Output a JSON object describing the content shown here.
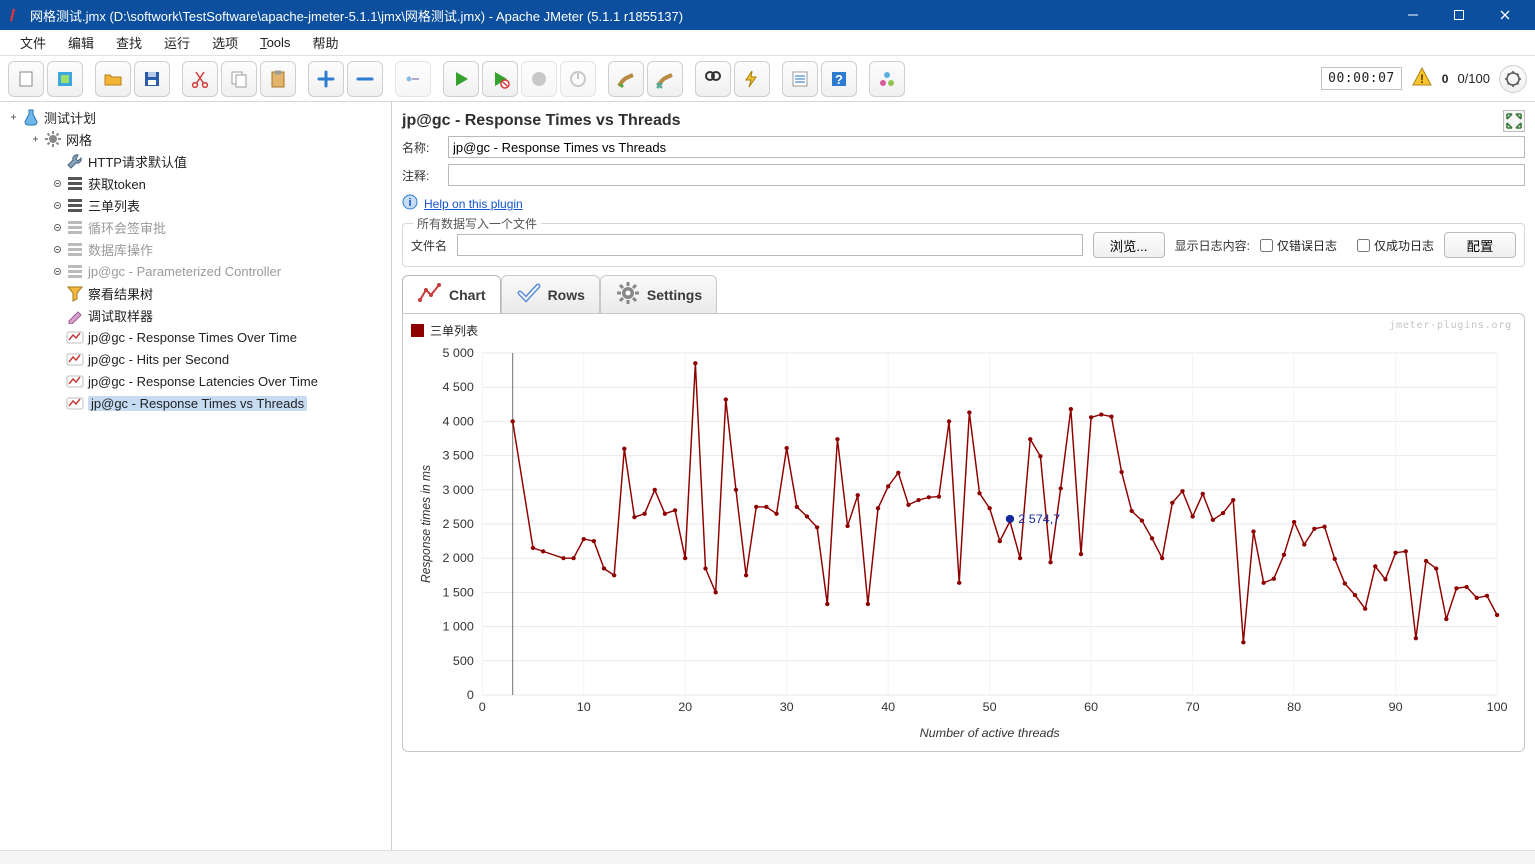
{
  "titlebar": {
    "title": "网格测试.jmx (D:\\softwork\\TestSoftware\\apache-jmeter-5.1.1\\jmx\\网格测试.jmx) - Apache JMeter (5.1.1 r1855137)"
  },
  "menubar": {
    "items": [
      "文件",
      "编辑",
      "查找",
      "运行",
      "选项",
      "Tools",
      "帮助"
    ]
  },
  "toolbar": {
    "timer": "00:00:07",
    "warn_count": "0",
    "thread_count": "0/100"
  },
  "tree": {
    "items": [
      {
        "label": "测试计划",
        "indent": 0,
        "toggle": "open",
        "icon": "flask"
      },
      {
        "label": "网格",
        "indent": 1,
        "toggle": "open",
        "icon": "gear"
      },
      {
        "label": "HTTP请求默认值",
        "indent": 2,
        "icon": "wrench"
      },
      {
        "label": "获取token",
        "indent": 2,
        "toggle": "closed",
        "icon": "bars"
      },
      {
        "label": "三单列表",
        "indent": 2,
        "toggle": "closed",
        "icon": "bars"
      },
      {
        "label": "循环会签审批",
        "indent": 2,
        "toggle": "closed",
        "icon": "bars-disabled",
        "disabled": true
      },
      {
        "label": "数据库操作",
        "indent": 2,
        "toggle": "closed",
        "icon": "bars-disabled",
        "disabled": true
      },
      {
        "label": "jp@gc - Parameterized Controller",
        "indent": 2,
        "toggle": "closed",
        "icon": "bars-disabled",
        "disabled": true
      },
      {
        "label": "察看结果树",
        "indent": 2,
        "icon": "funnel"
      },
      {
        "label": "调试取样器",
        "indent": 2,
        "icon": "pen"
      },
      {
        "label": "jp@gc - Response Times Over Time",
        "indent": 2,
        "icon": "jp"
      },
      {
        "label": "jp@gc - Hits per Second",
        "indent": 2,
        "icon": "jp"
      },
      {
        "label": "jp@gc - Response Latencies Over Time",
        "indent": 2,
        "icon": "jp"
      },
      {
        "label": "jp@gc - Response Times vs Threads",
        "indent": 2,
        "icon": "jp",
        "selected": true
      }
    ]
  },
  "main": {
    "header": "jp@gc - Response Times vs Threads",
    "name_label": "名称:",
    "name_value": "jp@gc - Response Times vs Threads",
    "comment_label": "注释:",
    "comment_value": "",
    "help_link": "Help on this plugin",
    "fieldset_legend": "所有数据写入一个文件",
    "filename_label": "文件名",
    "filename_value": "",
    "browse_btn": "浏览...",
    "showlog_label": "显示日志内容:",
    "cb_error": "仅错误日志",
    "cb_success": "仅成功日志",
    "config_btn": "配置"
  },
  "tabs": {
    "chart": "Chart",
    "rows": "Rows",
    "settings": "Settings"
  },
  "legend": {
    "series_name": "三单列表"
  },
  "watermark": "jmeter-plugins.org",
  "tooltip": {
    "label": "2 574,7"
  },
  "chart_data": {
    "type": "line",
    "title": "",
    "xlabel": "Number of active threads",
    "ylabel": "Response times in ms",
    "xlim": [
      0,
      100
    ],
    "ylim": [
      0,
      5000
    ],
    "x_ticks": [
      0,
      10,
      20,
      30,
      40,
      50,
      60,
      70,
      80,
      90,
      100
    ],
    "y_ticks": [
      0,
      500,
      1000,
      1500,
      2000,
      2500,
      3000,
      3500,
      4000,
      4500,
      5000
    ],
    "series": [
      {
        "name": "三单列表",
        "color": "#8e0000",
        "x": [
          3,
          5,
          6,
          8,
          9,
          10,
          11,
          12,
          13,
          14,
          15,
          16,
          17,
          18,
          19,
          20,
          21,
          22,
          23,
          24,
          25,
          26,
          27,
          28,
          29,
          30,
          31,
          32,
          33,
          34,
          35,
          36,
          37,
          38,
          39,
          40,
          41,
          42,
          43,
          44,
          45,
          46,
          47,
          48,
          49,
          50,
          51,
          52,
          53,
          54,
          55,
          56,
          57,
          58,
          59,
          60,
          61,
          62,
          63,
          64,
          65,
          66,
          67,
          68,
          69,
          70,
          71,
          72,
          73,
          74,
          75,
          76,
          77,
          78,
          79,
          80,
          81,
          82,
          83,
          84,
          85,
          86,
          87,
          88,
          89,
          90,
          91,
          92,
          93,
          94,
          95,
          96,
          97,
          98,
          99,
          100
        ],
        "values": [
          4000,
          2150,
          2100,
          2000,
          2000,
          2280,
          2250,
          1850,
          1750,
          3600,
          2600,
          2650,
          3000,
          2650,
          2700,
          2000,
          4850,
          1850,
          1500,
          4320,
          3000,
          1750,
          2750,
          2750,
          2650,
          3610,
          2750,
          2610,
          2450,
          1330,
          3740,
          2470,
          2920,
          1330,
          2730,
          3050,
          3250,
          2780,
          2850,
          2890,
          2900,
          4000,
          1640,
          4130,
          2950,
          2730,
          2250,
          2540,
          2000,
          3740,
          3490,
          1940,
          3020,
          4180,
          2060,
          4060,
          4100,
          4070,
          3260,
          2690,
          2550,
          2290,
          2000,
          2810,
          2980,
          2610,
          2940,
          2560,
          2660,
          2850,
          770,
          2390,
          1640,
          1700,
          2050,
          2530,
          2200,
          2430,
          2460,
          1990,
          1630,
          1460,
          1260,
          1880,
          1690,
          2080,
          2100,
          830,
          1960,
          1850,
          1110,
          1560,
          1580,
          1420,
          1450,
          1170
        ]
      }
    ],
    "tooltip_point": {
      "x": 52,
      "y": 2574.7
    }
  }
}
